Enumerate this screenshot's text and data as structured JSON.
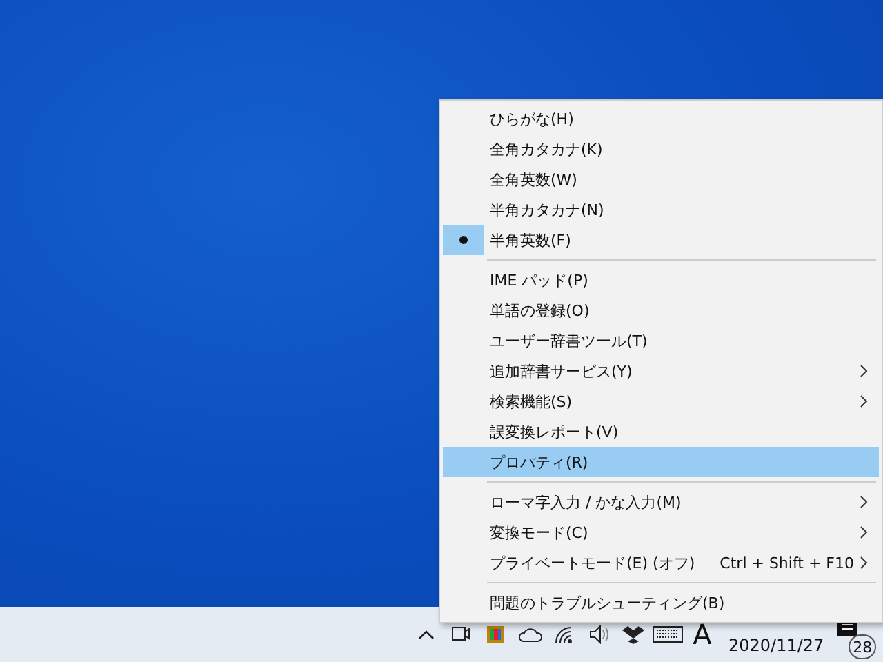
{
  "context_menu": {
    "sections": [
      [
        {
          "label": "ひらがな(H)",
          "checked": false,
          "selected": false,
          "submenu": false
        },
        {
          "label": "全角カタカナ(K)",
          "checked": false,
          "selected": false,
          "submenu": false
        },
        {
          "label": "全角英数(W)",
          "checked": false,
          "selected": false,
          "submenu": false
        },
        {
          "label": "半角カタカナ(N)",
          "checked": false,
          "selected": false,
          "submenu": false
        },
        {
          "label": "半角英数(F)",
          "checked": true,
          "selected": false,
          "submenu": false
        }
      ],
      [
        {
          "label": "IME パッド(P)",
          "checked": false,
          "selected": false,
          "submenu": false
        },
        {
          "label": "単語の登録(O)",
          "checked": false,
          "selected": false,
          "submenu": false
        },
        {
          "label": "ユーザー辞書ツール(T)",
          "checked": false,
          "selected": false,
          "submenu": false
        },
        {
          "label": "追加辞書サービス(Y)",
          "checked": false,
          "selected": false,
          "submenu": true
        },
        {
          "label": "検索機能(S)",
          "checked": false,
          "selected": false,
          "submenu": true
        },
        {
          "label": "誤変換レポート(V)",
          "checked": false,
          "selected": false,
          "submenu": false
        },
        {
          "label": "プロパティ(R)",
          "checked": false,
          "selected": true,
          "submenu": false
        }
      ],
      [
        {
          "label": "ローマ字入力 / かな入力(M)",
          "checked": false,
          "selected": false,
          "submenu": true
        },
        {
          "label": "変換モード(C)",
          "checked": false,
          "selected": false,
          "submenu": true
        },
        {
          "label": "プライベートモード(E) (オフ)",
          "shortcut": "Ctrl + Shift + F10",
          "checked": false,
          "selected": false,
          "submenu": true
        }
      ],
      [
        {
          "label": "問題のトラブルシューティング(B)",
          "checked": false,
          "selected": false,
          "submenu": false
        }
      ]
    ]
  },
  "taskbar": {
    "ime_mode": "A",
    "date": "2020/11/27",
    "notification_count": "28"
  }
}
